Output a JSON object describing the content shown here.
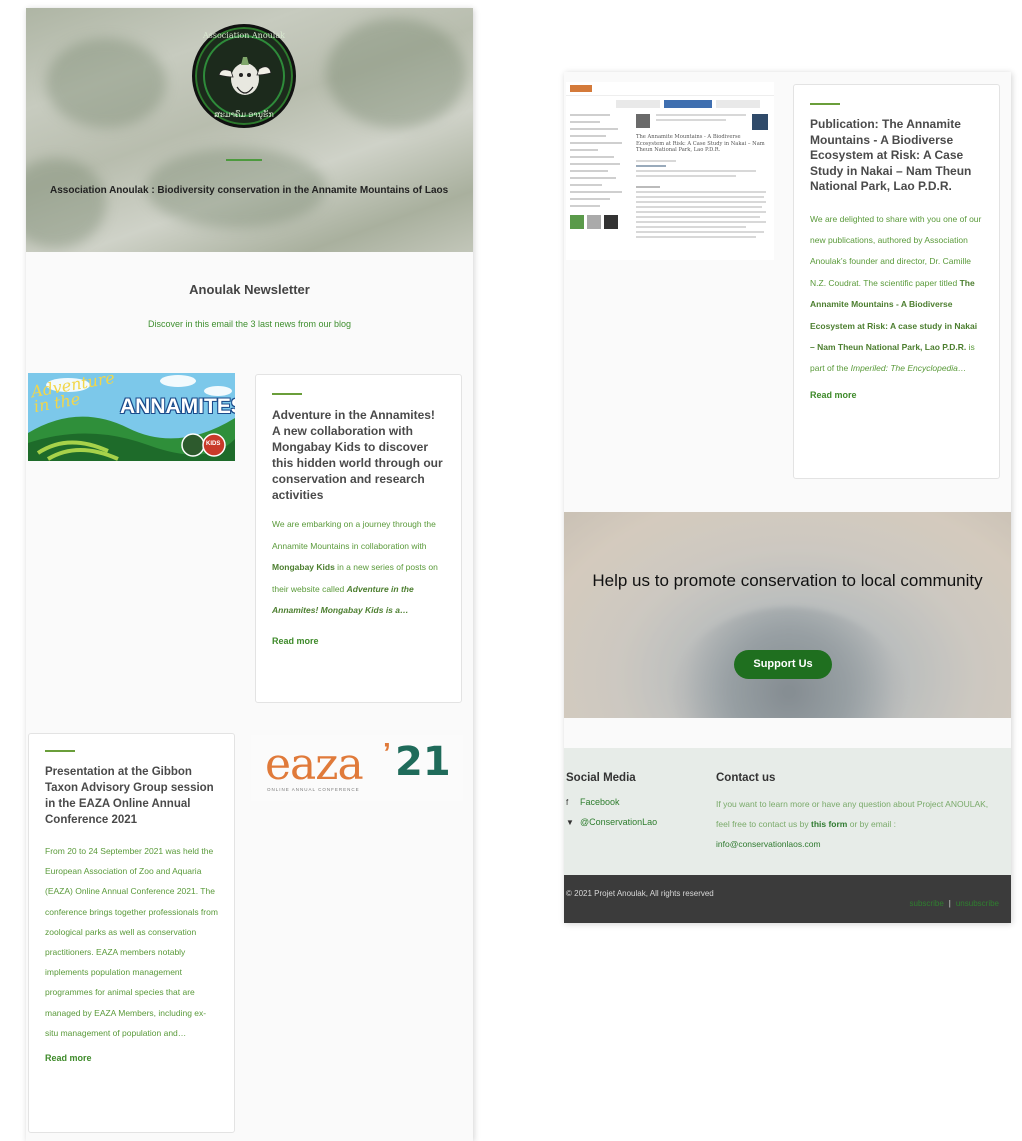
{
  "left": {
    "hero": {
      "logo_top_text": "Association Anoulak",
      "logo_bottom_text": "ສະມາຄົມ ອານຸຮັກ",
      "tagline": "Association Anoulak : Biodiversity conservation in the Annamite Mountains of Laos"
    },
    "newsletter_title": "Anoulak Newsletter",
    "newsletter_subtitle": "Discover in this email the 3 last news from our blog",
    "annamites_image": {
      "line1": "Adventure",
      "line2": "in the",
      "word": "ANNAMITES",
      "badge": "KIDS"
    },
    "post1": {
      "title": "Adventure in the Annamites! A new collaboration with Mongabay Kids to discover this hidden world through our conservation and research activities",
      "excerpt_a": "We are embarking on a journey through the Annamite Mountains in collaboration with ",
      "excerpt_b": "Mongabay Kids",
      "excerpt_c": " in a new series of posts on their website called ",
      "excerpt_d": "Adventure in the Annamites! Mongabay Kids is a…",
      "read_more": "Read more"
    },
    "post2": {
      "title": "Presentation at the Gibbon Taxon Advisory Group session in the EAZA Online Annual Conference 2021",
      "excerpt": "From 20 to 24 September 2021 was held the European Association of Zoo and Aquaria (EAZA) Online Annual Conference 2021. The conference brings together professionals from zoological parks as well as conservation practitioners. EAZA members notably implements population management programmes for animal species that are managed by EAZA Members, including ex-situ management of population and…",
      "read_more": "Read more"
    },
    "eaza_logo": {
      "text": "eaza",
      "apostrophe": "’",
      "year": "21",
      "sub": "ONLINE ANNUAL CONFERENCE"
    }
  },
  "right": {
    "pub_screenshot": {
      "title": "The Annamite Mountains - A Biodiverse Ecosystem at Risk: A Case Study in Nakai – Nam Theun National Park, Lao P.D.R."
    },
    "post3": {
      "title": "Publication: The Annamite Mountains - A Biodiverse Ecosystem at Risk: A Case Study in Nakai – Nam Theun National Park, Lao P.D.R.",
      "excerpt_a": "We are delighted to share with you one of our new publications, authored by Association Anoulak’s founder and director, Dr. Camille N.Z. Coudrat. The scientific paper titled ",
      "excerpt_b": "The Annamite Mountains - A Biodiverse Ecosystem at Risk: A case study in Nakai – Nam Theun National Park, Lao P.D.R.",
      "excerpt_c": " is part of the ",
      "excerpt_d": "Imperiled: The Encyclopedia…",
      "read_more": "Read more"
    },
    "promo": {
      "heading": "Help us to promote conservation to local community",
      "button": "Support Us"
    },
    "social": {
      "title": "Social Media",
      "facebook": "Facebook",
      "twitter": "@ConservationLao"
    },
    "contact": {
      "title": "Contact us",
      "text_a": "If you want to learn more or have any question about Project ANOULAK, feel free to contact us by ",
      "form_link": "this form",
      "text_b": " or by email : ",
      "email": "info@conservationlaos.com"
    },
    "footer": {
      "copyright": "© 2021 Projet Anoulak, All rights reserved",
      "subscribe": "subscribe",
      "unsubscribe": "unsubscribe",
      "separator": "|"
    }
  },
  "colors": {
    "accent_green": "#3e8a2a",
    "button_green": "#1f6f1f",
    "footer_bg": "#3b3b3b",
    "social_bg": "#e7ece8"
  }
}
